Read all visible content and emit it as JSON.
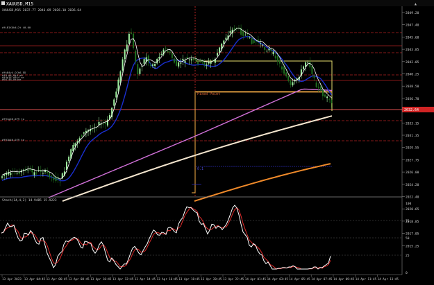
{
  "window": {
    "symbol_icon": "chart-window-icon",
    "title": "XAUUSD,M15",
    "ohlc_line": "XAUUSD,M15 2037.77 2046.09 2026.10 2036.64",
    "close_button": "close-icon"
  },
  "price_axis": {
    "ticks": [
      "2049.20",
      "2047.40",
      "2045.60",
      "2043.85",
      "2042.05",
      "2040.25",
      "2038.50",
      "2036.70",
      "2034.90",
      "2033.15",
      "2031.35",
      "2029.55",
      "2027.75",
      "2026.00",
      "2024.20",
      "2022.40",
      "2020.65",
      "2018.85",
      "2017.05",
      "2015.25"
    ],
    "current_price": "2032.64"
  },
  "objects": {
    "fixed_point_label": "Fixed Point",
    "level_label": "0.1"
  },
  "left_labels": [
    "#fiB1XOk4L2t 40.00",
    "#fkB4v4.OCh6.ED",
    "#f4.d4_0t4 eh",
    "#f4g14.d3t4 ar",
    "#94-46_0t4ve",
    "#f91g46.079 to",
    "#f91b46.079 to"
  ],
  "indicator": {
    "label": "Stoch(14,4,2) 14.9485 15.9223",
    "levels": [
      "100",
      "75",
      "50",
      "25",
      "0"
    ]
  },
  "time_axis": [
    "13 Apr 2023",
    "13 Apr 04:45",
    "13 Apr 06:45",
    "13 Apr 08:45",
    "13 Apr 10:45",
    "13 Apr 12:45",
    "13 Apr 14:45",
    "13 Apr 16:45",
    "13 Apr 18:45",
    "13 Apr 20:45",
    "13 Apr 22:45",
    "14 Apr 01:45",
    "14 Apr 03:45",
    "14 Apr 05:45",
    "14 Apr 07:45",
    "14 Apr 09:45",
    "14 Apr 11:45",
    "14 Apr 13:45"
  ],
  "colors": {
    "background": "#000000",
    "bull_candle": "#9fef9f",
    "bear_candle": "#1f6f1f",
    "ma_fast": "#ffffff",
    "ma_blue": "#1a2fd0",
    "ma_pink": "#d070d8",
    "ma_cream": "#f5e6cf",
    "ma_orange": "#f08a2a",
    "stoch_main": "#ffffff",
    "stoch_signal": "#e02a2a",
    "red_level": "#b22222",
    "fib_line": "#ffb347",
    "yellow_box": "#e8e070",
    "price_badge": "#d12424"
  }
}
